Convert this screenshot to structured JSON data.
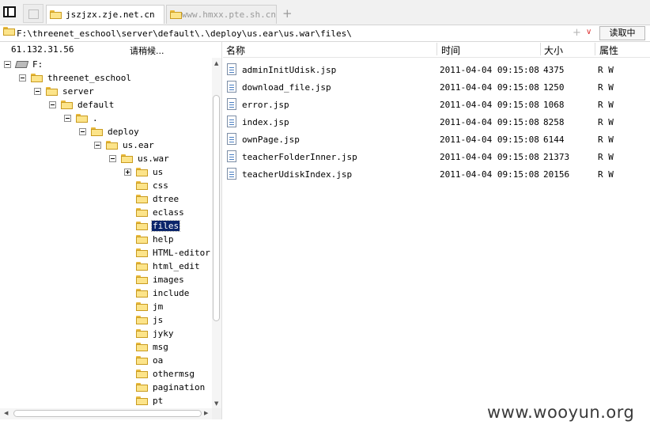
{
  "tabs": [
    {
      "label": "jszjzx.zje.net.cn",
      "active": true
    },
    {
      "label": "www.hmxx.pte.sh.cn",
      "active": false
    }
  ],
  "tab_add_symbol": "+",
  "address": {
    "value": "F:\\threenet_eschool\\server\\default\\.\\deploy\\us.ear\\us.war\\files\\",
    "read_button": "读取中"
  },
  "left_panel": {
    "ip": "61.132.31.56",
    "status": "请稍候..."
  },
  "tree": [
    {
      "label": "F:",
      "icon": "drive-icon",
      "expander": "minus"
    },
    {
      "label": "threenet_eschool",
      "icon": "folder-icon",
      "expander": "minus"
    },
    {
      "label": "server",
      "icon": "folder-icon",
      "expander": "minus"
    },
    {
      "label": "default",
      "icon": "folder-icon",
      "expander": "minus"
    },
    {
      "label": ".",
      "icon": "folder-icon",
      "expander": "minus"
    },
    {
      "label": "deploy",
      "icon": "folder-icon",
      "expander": "minus"
    },
    {
      "label": "us.ear",
      "icon": "folder-icon",
      "expander": "minus"
    },
    {
      "label": "us.war",
      "icon": "folder-icon",
      "expander": "minus"
    },
    {
      "label": "us",
      "icon": "folder-icon",
      "expander": "plus"
    },
    {
      "label": "css",
      "icon": "folder-icon",
      "expander": "none"
    },
    {
      "label": "dtree",
      "icon": "folder-icon",
      "expander": "none"
    },
    {
      "label": "eclass",
      "icon": "folder-icon",
      "expander": "none"
    },
    {
      "label": "files",
      "icon": "folder-icon",
      "expander": "none",
      "selected": true
    },
    {
      "label": "help",
      "icon": "folder-icon",
      "expander": "none"
    },
    {
      "label": "HTML-editor",
      "icon": "folder-icon",
      "expander": "none"
    },
    {
      "label": "html_edit",
      "icon": "folder-icon",
      "expander": "none"
    },
    {
      "label": "images",
      "icon": "folder-icon",
      "expander": "none"
    },
    {
      "label": "include",
      "icon": "folder-icon",
      "expander": "none"
    },
    {
      "label": "jm",
      "icon": "folder-icon",
      "expander": "none"
    },
    {
      "label": "js",
      "icon": "folder-icon",
      "expander": "none"
    },
    {
      "label": "jyky",
      "icon": "folder-icon",
      "expander": "none"
    },
    {
      "label": "msg",
      "icon": "folder-icon",
      "expander": "none"
    },
    {
      "label": "oa",
      "icon": "folder-icon",
      "expander": "none"
    },
    {
      "label": "othermsg",
      "icon": "folder-icon",
      "expander": "none"
    },
    {
      "label": "pagination",
      "icon": "folder-icon",
      "expander": "none"
    },
    {
      "label": "pt",
      "icon": "folder-icon",
      "expander": "none"
    }
  ],
  "file_list": {
    "columns": [
      "名称",
      "时间",
      "大小",
      "属性"
    ],
    "rows": [
      {
        "name": "adminInitUdisk.jsp",
        "time": "2011-04-04 09:15:08",
        "size": "4375",
        "attr": "R W"
      },
      {
        "name": "download_file.jsp",
        "time": "2011-04-04 09:15:08",
        "size": "1250",
        "attr": "R W"
      },
      {
        "name": "error.jsp",
        "time": "2011-04-04 09:15:08",
        "size": "1068",
        "attr": "R W"
      },
      {
        "name": "index.jsp",
        "time": "2011-04-04 09:15:08",
        "size": "8258",
        "attr": "R W"
      },
      {
        "name": "ownPage.jsp",
        "time": "2011-04-04 09:15:08",
        "size": "6144",
        "attr": "R W"
      },
      {
        "name": "teacherFolderInner.jsp",
        "time": "2011-04-04 09:15:08",
        "size": "21373",
        "attr": "R W"
      },
      {
        "name": "teacherUdiskIndex.jsp",
        "time": "2011-04-04 09:15:08",
        "size": "20156",
        "attr": "R W"
      }
    ]
  },
  "watermark": "www.wooyun.org",
  "colors": {
    "selection": "#0a246a",
    "folder": "#fce48a",
    "dropdown_arrow": "#dd3333"
  }
}
